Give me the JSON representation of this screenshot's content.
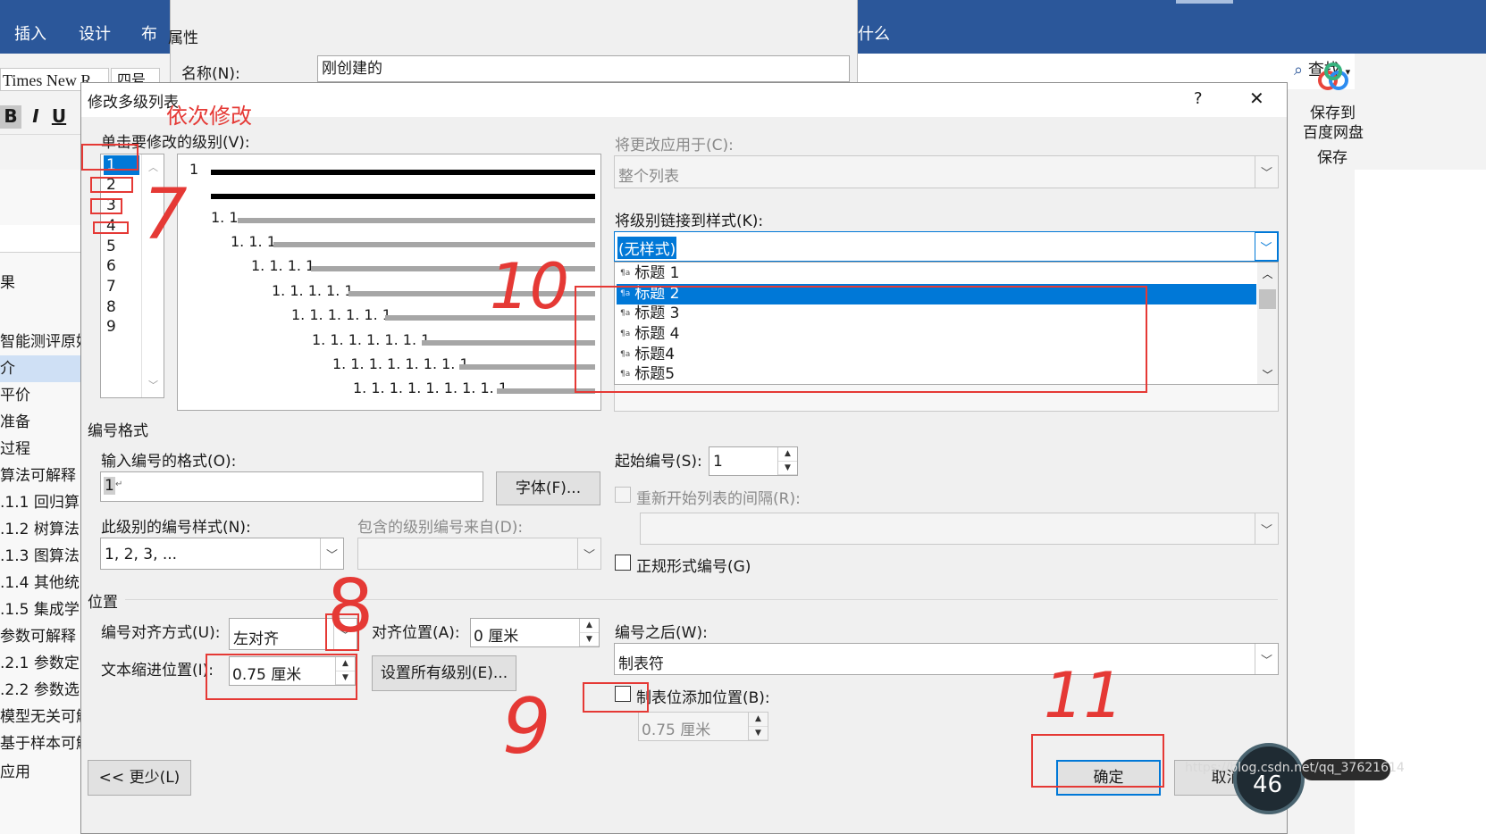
{
  "ribbon": {
    "tabs": [
      "插入",
      "设计",
      "布",
      "什么"
    ],
    "font_name": "Times New R",
    "font_size": "四号",
    "bold": "B",
    "italic": "I",
    "underline": "U",
    "search_label": "查找",
    "baidu_label_1": "保存到",
    "baidu_label_2": "百度网盘",
    "baidu_group": "保存"
  },
  "nav_items": [
    "果",
    "智能测评原始",
    "介",
    "平价",
    "准备",
    "过程",
    "算法可解释",
    ".1.1 回归算",
    ".1.2 树算法",
    ".1.3 图算法",
    ".1.4 其他统",
    ".1.5 集成学",
    "参数可解释",
    ".2.1 参数定",
    ".2.2 参数选",
    "模型无关可解",
    "基于样本可解",
    "应用"
  ],
  "back_dialog": {
    "properties_label": "属性",
    "name_label": "名称(N):",
    "name_value": "刚创建的"
  },
  "dialog": {
    "title": "修改多级列表",
    "help": "?",
    "close": "✕",
    "click_level_label": "单击要修改的级别(V):",
    "levels": [
      "1",
      "2",
      "3",
      "4",
      "5",
      "6",
      "7",
      "8",
      "9"
    ],
    "preview_numbers": [
      "1",
      "1. 1",
      "1. 1. 1",
      "1. 1. 1. 1",
      "1. 1. 1. 1. 1",
      "1. 1. 1. 1. 1. 1",
      "1. 1. 1. 1. 1. 1. 1",
      "1. 1. 1. 1. 1. 1. 1. 1",
      "1. 1. 1. 1. 1. 1. 1. 1. 1"
    ],
    "apply_to_label": "将更改应用于(C):",
    "apply_to_value": "整个列表",
    "link_style_label": "将级别链接到样式(K):",
    "link_style_value": "(无样式)",
    "style_options": [
      "标题 1",
      "标题 2",
      "标题 3",
      "标题 4",
      "标题4",
      "标题5"
    ],
    "style_icon": "¶a",
    "number_format_section": "编号格式",
    "enter_format_label": "输入编号的格式(O):",
    "enter_format_value": "1",
    "font_button": "字体(F)...",
    "number_style_label": "此级别的编号样式(N):",
    "number_style_value": "1, 2, 3, ...",
    "include_level_label": "包含的级别编号来自(D):",
    "start_at_label": "起始编号(S):",
    "start_at_value": "1",
    "restart_label": "重新开始列表的间隔(R):",
    "legal_label": "正规形式编号(G)",
    "position_section": "位置",
    "alignment_label": "编号对齐方式(U):",
    "alignment_value": "左对齐",
    "aligned_at_label": "对齐位置(A):",
    "aligned_at_value": "0 厘米",
    "indent_label": "文本缩进位置(I):",
    "indent_value": "0.75 厘米",
    "set_all_button": "设置所有级别(E)...",
    "follow_label": "编号之后(W):",
    "follow_value": "制表符",
    "tab_stop_label": "制表位添加位置(B):",
    "tab_stop_value": "0.75 厘米",
    "less_button": "<< 更少(L)",
    "ok_button": "确定",
    "cancel_button": "取消"
  },
  "annotations": {
    "note": "依次修改",
    "n7": "7",
    "n8": "8",
    "n9": "9",
    "n10": "10",
    "n11": "11"
  },
  "watermark": "https://blog.csdn.net/qq_37621614",
  "speed_badge": "46",
  "colors": {
    "ribbon": "#2b579a",
    "selection": "#0078d7",
    "annotation": "#e53935"
  }
}
